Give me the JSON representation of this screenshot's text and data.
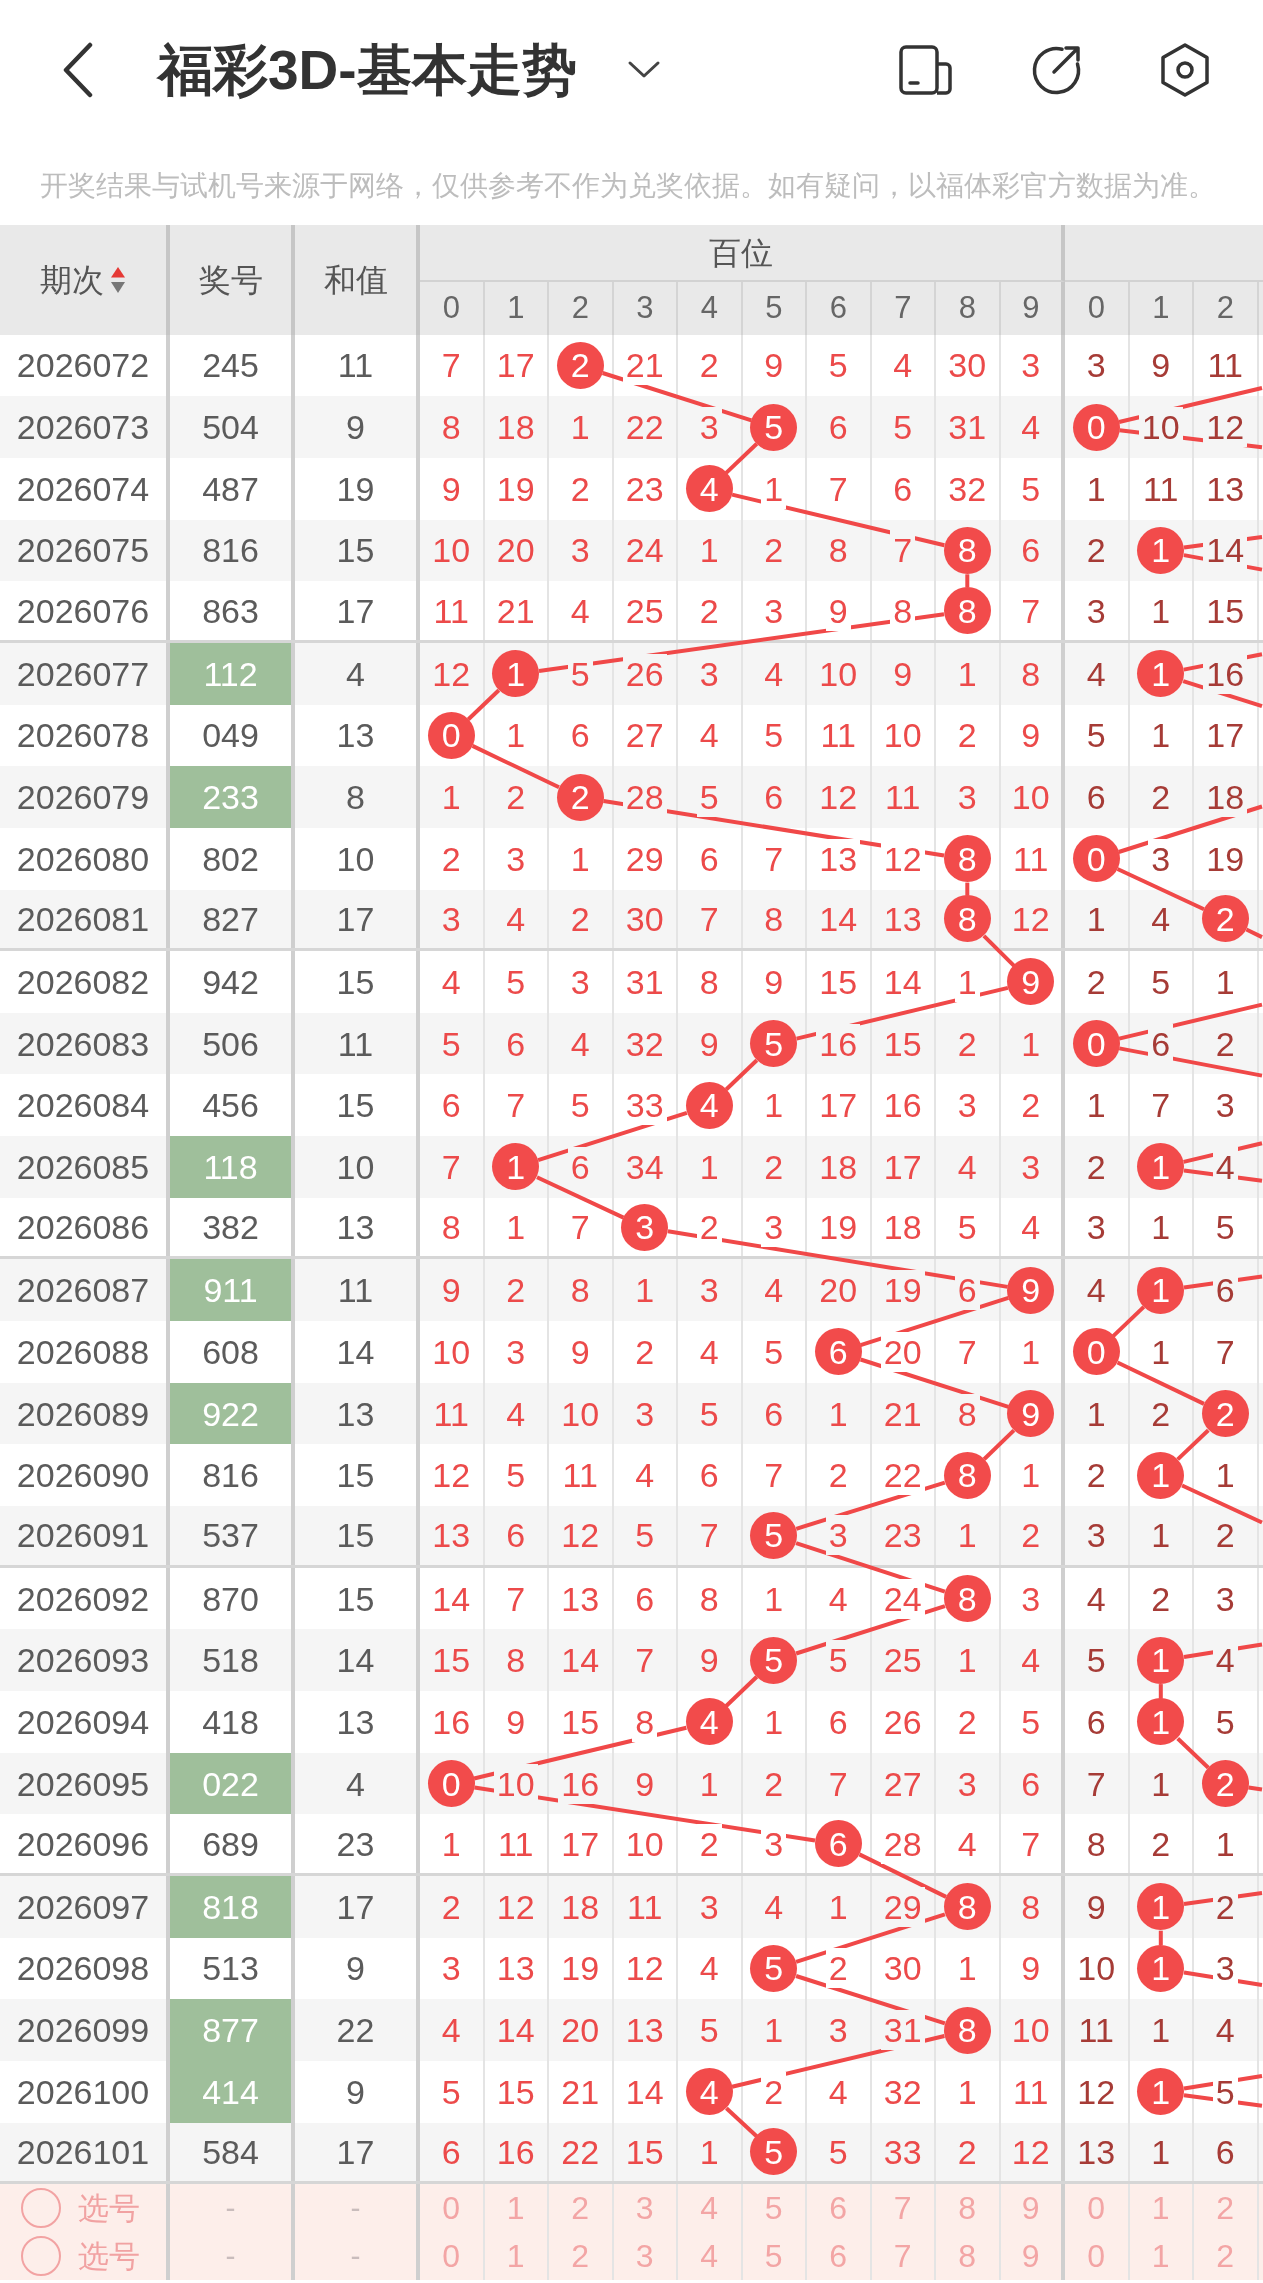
{
  "title_bar": {
    "title": "福彩3D-基本走势"
  },
  "disclaimer": "开奖结果与试机号来源于网络，仅供参考不作为兑奖依据。如有疑问，以福体彩官方数据为准。",
  "table": {
    "headers": {
      "period": "期次",
      "number": "奖号",
      "sum": "和值",
      "hundreds": "百位"
    },
    "sort_ascending": true,
    "hundreds_digits": [
      "0",
      "1",
      "2",
      "3",
      "4",
      "5",
      "6",
      "7",
      "8",
      "9"
    ],
    "tens_digits": [
      "0",
      "1",
      "2"
    ],
    "rows": [
      {
        "period": "2026072",
        "number": "245",
        "sum": "11",
        "highlighted": false,
        "hundreds": [
          {
            "text": "7",
            "hit": false
          },
          {
            "text": "17",
            "hit": false
          },
          {
            "text": "2",
            "hit": true
          },
          {
            "text": "21",
            "hit": false
          },
          {
            "text": "2",
            "hit": false
          },
          {
            "text": "9",
            "hit": false
          },
          {
            "text": "5",
            "hit": false
          },
          {
            "text": "4",
            "hit": false
          },
          {
            "text": "30",
            "hit": false
          },
          {
            "text": "3",
            "hit": false
          }
        ],
        "tens": [
          {
            "text": "3",
            "hit": false
          },
          {
            "text": "9",
            "hit": false
          },
          {
            "text": "11",
            "hit": false
          }
        ]
      },
      {
        "period": "2026073",
        "number": "504",
        "sum": "9",
        "highlighted": false,
        "hundreds": [
          {
            "text": "8",
            "hit": false
          },
          {
            "text": "18",
            "hit": false
          },
          {
            "text": "1",
            "hit": false
          },
          {
            "text": "22",
            "hit": false
          },
          {
            "text": "3",
            "hit": false
          },
          {
            "text": "5",
            "hit": true
          },
          {
            "text": "6",
            "hit": false
          },
          {
            "text": "5",
            "hit": false
          },
          {
            "text": "31",
            "hit": false
          },
          {
            "text": "4",
            "hit": false
          }
        ],
        "tens": [
          {
            "text": "0",
            "hit": true
          },
          {
            "text": "10",
            "hit": false
          },
          {
            "text": "12",
            "hit": false
          }
        ]
      },
      {
        "period": "2026074",
        "number": "487",
        "sum": "19",
        "highlighted": false,
        "hundreds": [
          {
            "text": "9",
            "hit": false
          },
          {
            "text": "19",
            "hit": false
          },
          {
            "text": "2",
            "hit": false
          },
          {
            "text": "23",
            "hit": false
          },
          {
            "text": "4",
            "hit": true
          },
          {
            "text": "1",
            "hit": false
          },
          {
            "text": "7",
            "hit": false
          },
          {
            "text": "6",
            "hit": false
          },
          {
            "text": "32",
            "hit": false
          },
          {
            "text": "5",
            "hit": false
          }
        ],
        "tens": [
          {
            "text": "1",
            "hit": false
          },
          {
            "text": "11",
            "hit": false
          },
          {
            "text": "13",
            "hit": false
          }
        ]
      },
      {
        "period": "2026075",
        "number": "816",
        "sum": "15",
        "highlighted": false,
        "hundreds": [
          {
            "text": "10",
            "hit": false
          },
          {
            "text": "20",
            "hit": false
          },
          {
            "text": "3",
            "hit": false
          },
          {
            "text": "24",
            "hit": false
          },
          {
            "text": "1",
            "hit": false
          },
          {
            "text": "2",
            "hit": false
          },
          {
            "text": "8",
            "hit": false
          },
          {
            "text": "7",
            "hit": false
          },
          {
            "text": "8",
            "hit": true
          },
          {
            "text": "6",
            "hit": false
          }
        ],
        "tens": [
          {
            "text": "2",
            "hit": false
          },
          {
            "text": "1",
            "hit": true
          },
          {
            "text": "14",
            "hit": false
          }
        ]
      },
      {
        "period": "2026076",
        "number": "863",
        "sum": "17",
        "highlighted": false,
        "hundreds": [
          {
            "text": "11",
            "hit": false
          },
          {
            "text": "21",
            "hit": false
          },
          {
            "text": "4",
            "hit": false
          },
          {
            "text": "25",
            "hit": false
          },
          {
            "text": "2",
            "hit": false
          },
          {
            "text": "3",
            "hit": false
          },
          {
            "text": "9",
            "hit": false
          },
          {
            "text": "8",
            "hit": false
          },
          {
            "text": "8",
            "hit": true
          },
          {
            "text": "7",
            "hit": false
          }
        ],
        "tens": [
          {
            "text": "3",
            "hit": false
          },
          {
            "text": "1",
            "hit": false
          },
          {
            "text": "15",
            "hit": false
          }
        ]
      },
      {
        "period": "2026077",
        "number": "112",
        "sum": "4",
        "highlighted": true,
        "hundreds": [
          {
            "text": "12",
            "hit": false
          },
          {
            "text": "1",
            "hit": true
          },
          {
            "text": "5",
            "hit": false
          },
          {
            "text": "26",
            "hit": false
          },
          {
            "text": "3",
            "hit": false
          },
          {
            "text": "4",
            "hit": false
          },
          {
            "text": "10",
            "hit": false
          },
          {
            "text": "9",
            "hit": false
          },
          {
            "text": "1",
            "hit": false
          },
          {
            "text": "8",
            "hit": false
          }
        ],
        "tens": [
          {
            "text": "4",
            "hit": false
          },
          {
            "text": "1",
            "hit": true
          },
          {
            "text": "16",
            "hit": false
          }
        ]
      },
      {
        "period": "2026078",
        "number": "049",
        "sum": "13",
        "highlighted": false,
        "hundreds": [
          {
            "text": "0",
            "hit": true
          },
          {
            "text": "1",
            "hit": false
          },
          {
            "text": "6",
            "hit": false
          },
          {
            "text": "27",
            "hit": false
          },
          {
            "text": "4",
            "hit": false
          },
          {
            "text": "5",
            "hit": false
          },
          {
            "text": "11",
            "hit": false
          },
          {
            "text": "10",
            "hit": false
          },
          {
            "text": "2",
            "hit": false
          },
          {
            "text": "9",
            "hit": false
          }
        ],
        "tens": [
          {
            "text": "5",
            "hit": false
          },
          {
            "text": "1",
            "hit": false
          },
          {
            "text": "17",
            "hit": false
          }
        ]
      },
      {
        "period": "2026079",
        "number": "233",
        "sum": "8",
        "highlighted": true,
        "hundreds": [
          {
            "text": "1",
            "hit": false
          },
          {
            "text": "2",
            "hit": false
          },
          {
            "text": "2",
            "hit": true
          },
          {
            "text": "28",
            "hit": false
          },
          {
            "text": "5",
            "hit": false
          },
          {
            "text": "6",
            "hit": false
          },
          {
            "text": "12",
            "hit": false
          },
          {
            "text": "11",
            "hit": false
          },
          {
            "text": "3",
            "hit": false
          },
          {
            "text": "10",
            "hit": false
          }
        ],
        "tens": [
          {
            "text": "6",
            "hit": false
          },
          {
            "text": "2",
            "hit": false
          },
          {
            "text": "18",
            "hit": false
          }
        ]
      },
      {
        "period": "2026080",
        "number": "802",
        "sum": "10",
        "highlighted": false,
        "hundreds": [
          {
            "text": "2",
            "hit": false
          },
          {
            "text": "3",
            "hit": false
          },
          {
            "text": "1",
            "hit": false
          },
          {
            "text": "29",
            "hit": false
          },
          {
            "text": "6",
            "hit": false
          },
          {
            "text": "7",
            "hit": false
          },
          {
            "text": "13",
            "hit": false
          },
          {
            "text": "12",
            "hit": false
          },
          {
            "text": "8",
            "hit": true
          },
          {
            "text": "11",
            "hit": false
          }
        ],
        "tens": [
          {
            "text": "0",
            "hit": true
          },
          {
            "text": "3",
            "hit": false
          },
          {
            "text": "19",
            "hit": false
          }
        ]
      },
      {
        "period": "2026081",
        "number": "827",
        "sum": "17",
        "highlighted": false,
        "hundreds": [
          {
            "text": "3",
            "hit": false
          },
          {
            "text": "4",
            "hit": false
          },
          {
            "text": "2",
            "hit": false
          },
          {
            "text": "30",
            "hit": false
          },
          {
            "text": "7",
            "hit": false
          },
          {
            "text": "8",
            "hit": false
          },
          {
            "text": "14",
            "hit": false
          },
          {
            "text": "13",
            "hit": false
          },
          {
            "text": "8",
            "hit": true
          },
          {
            "text": "12",
            "hit": false
          }
        ],
        "tens": [
          {
            "text": "1",
            "hit": false
          },
          {
            "text": "4",
            "hit": false
          },
          {
            "text": "2",
            "hit": true
          }
        ]
      },
      {
        "period": "2026082",
        "number": "942",
        "sum": "15",
        "highlighted": false,
        "hundreds": [
          {
            "text": "4",
            "hit": false
          },
          {
            "text": "5",
            "hit": false
          },
          {
            "text": "3",
            "hit": false
          },
          {
            "text": "31",
            "hit": false
          },
          {
            "text": "8",
            "hit": false
          },
          {
            "text": "9",
            "hit": false
          },
          {
            "text": "15",
            "hit": false
          },
          {
            "text": "14",
            "hit": false
          },
          {
            "text": "1",
            "hit": false
          },
          {
            "text": "9",
            "hit": true
          }
        ],
        "tens": [
          {
            "text": "2",
            "hit": false
          },
          {
            "text": "5",
            "hit": false
          },
          {
            "text": "1",
            "hit": false
          }
        ]
      },
      {
        "period": "2026083",
        "number": "506",
        "sum": "11",
        "highlighted": false,
        "hundreds": [
          {
            "text": "5",
            "hit": false
          },
          {
            "text": "6",
            "hit": false
          },
          {
            "text": "4",
            "hit": false
          },
          {
            "text": "32",
            "hit": false
          },
          {
            "text": "9",
            "hit": false
          },
          {
            "text": "5",
            "hit": true
          },
          {
            "text": "16",
            "hit": false
          },
          {
            "text": "15",
            "hit": false
          },
          {
            "text": "2",
            "hit": false
          },
          {
            "text": "1",
            "hit": false
          }
        ],
        "tens": [
          {
            "text": "0",
            "hit": true
          },
          {
            "text": "6",
            "hit": false
          },
          {
            "text": "2",
            "hit": false
          }
        ]
      },
      {
        "period": "2026084",
        "number": "456",
        "sum": "15",
        "highlighted": false,
        "hundreds": [
          {
            "text": "6",
            "hit": false
          },
          {
            "text": "7",
            "hit": false
          },
          {
            "text": "5",
            "hit": false
          },
          {
            "text": "33",
            "hit": false
          },
          {
            "text": "4",
            "hit": true
          },
          {
            "text": "1",
            "hit": false
          },
          {
            "text": "17",
            "hit": false
          },
          {
            "text": "16",
            "hit": false
          },
          {
            "text": "3",
            "hit": false
          },
          {
            "text": "2",
            "hit": false
          }
        ],
        "tens": [
          {
            "text": "1",
            "hit": false
          },
          {
            "text": "7",
            "hit": false
          },
          {
            "text": "3",
            "hit": false
          }
        ]
      },
      {
        "period": "2026085",
        "number": "118",
        "sum": "10",
        "highlighted": true,
        "hundreds": [
          {
            "text": "7",
            "hit": false
          },
          {
            "text": "1",
            "hit": true
          },
          {
            "text": "6",
            "hit": false
          },
          {
            "text": "34",
            "hit": false
          },
          {
            "text": "1",
            "hit": false
          },
          {
            "text": "2",
            "hit": false
          },
          {
            "text": "18",
            "hit": false
          },
          {
            "text": "17",
            "hit": false
          },
          {
            "text": "4",
            "hit": false
          },
          {
            "text": "3",
            "hit": false
          }
        ],
        "tens": [
          {
            "text": "2",
            "hit": false
          },
          {
            "text": "1",
            "hit": true
          },
          {
            "text": "4",
            "hit": false
          }
        ]
      },
      {
        "period": "2026086",
        "number": "382",
        "sum": "13",
        "highlighted": false,
        "hundreds": [
          {
            "text": "8",
            "hit": false
          },
          {
            "text": "1",
            "hit": false
          },
          {
            "text": "7",
            "hit": false
          },
          {
            "text": "3",
            "hit": true
          },
          {
            "text": "2",
            "hit": false
          },
          {
            "text": "3",
            "hit": false
          },
          {
            "text": "19",
            "hit": false
          },
          {
            "text": "18",
            "hit": false
          },
          {
            "text": "5",
            "hit": false
          },
          {
            "text": "4",
            "hit": false
          }
        ],
        "tens": [
          {
            "text": "3",
            "hit": false
          },
          {
            "text": "1",
            "hit": false
          },
          {
            "text": "5",
            "hit": false
          }
        ]
      },
      {
        "period": "2026087",
        "number": "911",
        "sum": "11",
        "highlighted": true,
        "hundreds": [
          {
            "text": "9",
            "hit": false
          },
          {
            "text": "2",
            "hit": false
          },
          {
            "text": "8",
            "hit": false
          },
          {
            "text": "1",
            "hit": false
          },
          {
            "text": "3",
            "hit": false
          },
          {
            "text": "4",
            "hit": false
          },
          {
            "text": "20",
            "hit": false
          },
          {
            "text": "19",
            "hit": false
          },
          {
            "text": "6",
            "hit": false
          },
          {
            "text": "9",
            "hit": true
          }
        ],
        "tens": [
          {
            "text": "4",
            "hit": false
          },
          {
            "text": "1",
            "hit": true
          },
          {
            "text": "6",
            "hit": false
          }
        ]
      },
      {
        "period": "2026088",
        "number": "608",
        "sum": "14",
        "highlighted": false,
        "hundreds": [
          {
            "text": "10",
            "hit": false
          },
          {
            "text": "3",
            "hit": false
          },
          {
            "text": "9",
            "hit": false
          },
          {
            "text": "2",
            "hit": false
          },
          {
            "text": "4",
            "hit": false
          },
          {
            "text": "5",
            "hit": false
          },
          {
            "text": "6",
            "hit": true
          },
          {
            "text": "20",
            "hit": false
          },
          {
            "text": "7",
            "hit": false
          },
          {
            "text": "1",
            "hit": false
          }
        ],
        "tens": [
          {
            "text": "0",
            "hit": true
          },
          {
            "text": "1",
            "hit": false
          },
          {
            "text": "7",
            "hit": false
          }
        ]
      },
      {
        "period": "2026089",
        "number": "922",
        "sum": "13",
        "highlighted": true,
        "hundreds": [
          {
            "text": "11",
            "hit": false
          },
          {
            "text": "4",
            "hit": false
          },
          {
            "text": "10",
            "hit": false
          },
          {
            "text": "3",
            "hit": false
          },
          {
            "text": "5",
            "hit": false
          },
          {
            "text": "6",
            "hit": false
          },
          {
            "text": "1",
            "hit": false
          },
          {
            "text": "21",
            "hit": false
          },
          {
            "text": "8",
            "hit": false
          },
          {
            "text": "9",
            "hit": true
          }
        ],
        "tens": [
          {
            "text": "1",
            "hit": false
          },
          {
            "text": "2",
            "hit": false
          },
          {
            "text": "2",
            "hit": true
          }
        ]
      },
      {
        "period": "2026090",
        "number": "816",
        "sum": "15",
        "highlighted": false,
        "hundreds": [
          {
            "text": "12",
            "hit": false
          },
          {
            "text": "5",
            "hit": false
          },
          {
            "text": "11",
            "hit": false
          },
          {
            "text": "4",
            "hit": false
          },
          {
            "text": "6",
            "hit": false
          },
          {
            "text": "7",
            "hit": false
          },
          {
            "text": "2",
            "hit": false
          },
          {
            "text": "22",
            "hit": false
          },
          {
            "text": "8",
            "hit": true
          },
          {
            "text": "1",
            "hit": false
          }
        ],
        "tens": [
          {
            "text": "2",
            "hit": false
          },
          {
            "text": "1",
            "hit": true
          },
          {
            "text": "1",
            "hit": false
          }
        ]
      },
      {
        "period": "2026091",
        "number": "537",
        "sum": "15",
        "highlighted": false,
        "hundreds": [
          {
            "text": "13",
            "hit": false
          },
          {
            "text": "6",
            "hit": false
          },
          {
            "text": "12",
            "hit": false
          },
          {
            "text": "5",
            "hit": false
          },
          {
            "text": "7",
            "hit": false
          },
          {
            "text": "5",
            "hit": true
          },
          {
            "text": "3",
            "hit": false
          },
          {
            "text": "23",
            "hit": false
          },
          {
            "text": "1",
            "hit": false
          },
          {
            "text": "2",
            "hit": false
          }
        ],
        "tens": [
          {
            "text": "3",
            "hit": false
          },
          {
            "text": "1",
            "hit": false
          },
          {
            "text": "2",
            "hit": false
          }
        ]
      },
      {
        "period": "2026092",
        "number": "870",
        "sum": "15",
        "highlighted": false,
        "hundreds": [
          {
            "text": "14",
            "hit": false
          },
          {
            "text": "7",
            "hit": false
          },
          {
            "text": "13",
            "hit": false
          },
          {
            "text": "6",
            "hit": false
          },
          {
            "text": "8",
            "hit": false
          },
          {
            "text": "1",
            "hit": false
          },
          {
            "text": "4",
            "hit": false
          },
          {
            "text": "24",
            "hit": false
          },
          {
            "text": "8",
            "hit": true
          },
          {
            "text": "3",
            "hit": false
          }
        ],
        "tens": [
          {
            "text": "4",
            "hit": false
          },
          {
            "text": "2",
            "hit": false
          },
          {
            "text": "3",
            "hit": false
          }
        ]
      },
      {
        "period": "2026093",
        "number": "518",
        "sum": "14",
        "highlighted": false,
        "hundreds": [
          {
            "text": "15",
            "hit": false
          },
          {
            "text": "8",
            "hit": false
          },
          {
            "text": "14",
            "hit": false
          },
          {
            "text": "7",
            "hit": false
          },
          {
            "text": "9",
            "hit": false
          },
          {
            "text": "5",
            "hit": true
          },
          {
            "text": "5",
            "hit": false
          },
          {
            "text": "25",
            "hit": false
          },
          {
            "text": "1",
            "hit": false
          },
          {
            "text": "4",
            "hit": false
          }
        ],
        "tens": [
          {
            "text": "5",
            "hit": false
          },
          {
            "text": "1",
            "hit": true
          },
          {
            "text": "4",
            "hit": false
          }
        ]
      },
      {
        "period": "2026094",
        "number": "418",
        "sum": "13",
        "highlighted": false,
        "hundreds": [
          {
            "text": "16",
            "hit": false
          },
          {
            "text": "9",
            "hit": false
          },
          {
            "text": "15",
            "hit": false
          },
          {
            "text": "8",
            "hit": false
          },
          {
            "text": "4",
            "hit": true
          },
          {
            "text": "1",
            "hit": false
          },
          {
            "text": "6",
            "hit": false
          },
          {
            "text": "26",
            "hit": false
          },
          {
            "text": "2",
            "hit": false
          },
          {
            "text": "5",
            "hit": false
          }
        ],
        "tens": [
          {
            "text": "6",
            "hit": false
          },
          {
            "text": "1",
            "hit": true
          },
          {
            "text": "5",
            "hit": false
          }
        ]
      },
      {
        "period": "2026095",
        "number": "022",
        "sum": "4",
        "highlighted": true,
        "hundreds": [
          {
            "text": "0",
            "hit": true
          },
          {
            "text": "10",
            "hit": false
          },
          {
            "text": "16",
            "hit": false
          },
          {
            "text": "9",
            "hit": false
          },
          {
            "text": "1",
            "hit": false
          },
          {
            "text": "2",
            "hit": false
          },
          {
            "text": "7",
            "hit": false
          },
          {
            "text": "27",
            "hit": false
          },
          {
            "text": "3",
            "hit": false
          },
          {
            "text": "6",
            "hit": false
          }
        ],
        "tens": [
          {
            "text": "7",
            "hit": false
          },
          {
            "text": "1",
            "hit": false
          },
          {
            "text": "2",
            "hit": true
          }
        ]
      },
      {
        "period": "2026096",
        "number": "689",
        "sum": "23",
        "highlighted": false,
        "hundreds": [
          {
            "text": "1",
            "hit": false
          },
          {
            "text": "11",
            "hit": false
          },
          {
            "text": "17",
            "hit": false
          },
          {
            "text": "10",
            "hit": false
          },
          {
            "text": "2",
            "hit": false
          },
          {
            "text": "3",
            "hit": false
          },
          {
            "text": "6",
            "hit": true
          },
          {
            "text": "28",
            "hit": false
          },
          {
            "text": "4",
            "hit": false
          },
          {
            "text": "7",
            "hit": false
          }
        ],
        "tens": [
          {
            "text": "8",
            "hit": false
          },
          {
            "text": "2",
            "hit": false
          },
          {
            "text": "1",
            "hit": false
          }
        ]
      },
      {
        "period": "2026097",
        "number": "818",
        "sum": "17",
        "highlighted": true,
        "hundreds": [
          {
            "text": "2",
            "hit": false
          },
          {
            "text": "12",
            "hit": false
          },
          {
            "text": "18",
            "hit": false
          },
          {
            "text": "11",
            "hit": false
          },
          {
            "text": "3",
            "hit": false
          },
          {
            "text": "4",
            "hit": false
          },
          {
            "text": "1",
            "hit": false
          },
          {
            "text": "29",
            "hit": false
          },
          {
            "text": "8",
            "hit": true
          },
          {
            "text": "8",
            "hit": false
          }
        ],
        "tens": [
          {
            "text": "9",
            "hit": false
          },
          {
            "text": "1",
            "hit": true
          },
          {
            "text": "2",
            "hit": false
          }
        ]
      },
      {
        "period": "2026098",
        "number": "513",
        "sum": "9",
        "highlighted": false,
        "hundreds": [
          {
            "text": "3",
            "hit": false
          },
          {
            "text": "13",
            "hit": false
          },
          {
            "text": "19",
            "hit": false
          },
          {
            "text": "12",
            "hit": false
          },
          {
            "text": "4",
            "hit": false
          },
          {
            "text": "5",
            "hit": true
          },
          {
            "text": "2",
            "hit": false
          },
          {
            "text": "30",
            "hit": false
          },
          {
            "text": "1",
            "hit": false
          },
          {
            "text": "9",
            "hit": false
          }
        ],
        "tens": [
          {
            "text": "10",
            "hit": false
          },
          {
            "text": "1",
            "hit": true
          },
          {
            "text": "3",
            "hit": false
          }
        ]
      },
      {
        "period": "2026099",
        "number": "877",
        "sum": "22",
        "highlighted": true,
        "hundreds": [
          {
            "text": "4",
            "hit": false
          },
          {
            "text": "14",
            "hit": false
          },
          {
            "text": "20",
            "hit": false
          },
          {
            "text": "13",
            "hit": false
          },
          {
            "text": "5",
            "hit": false
          },
          {
            "text": "1",
            "hit": false
          },
          {
            "text": "3",
            "hit": false
          },
          {
            "text": "31",
            "hit": false
          },
          {
            "text": "8",
            "hit": true
          },
          {
            "text": "10",
            "hit": false
          }
        ],
        "tens": [
          {
            "text": "11",
            "hit": false
          },
          {
            "text": "1",
            "hit": false
          },
          {
            "text": "4",
            "hit": false
          }
        ]
      },
      {
        "period": "2026100",
        "number": "414",
        "sum": "9",
        "highlighted": true,
        "hundreds": [
          {
            "text": "5",
            "hit": false
          },
          {
            "text": "15",
            "hit": false
          },
          {
            "text": "21",
            "hit": false
          },
          {
            "text": "14",
            "hit": false
          },
          {
            "text": "4",
            "hit": true
          },
          {
            "text": "2",
            "hit": false
          },
          {
            "text": "4",
            "hit": false
          },
          {
            "text": "32",
            "hit": false
          },
          {
            "text": "1",
            "hit": false
          },
          {
            "text": "11",
            "hit": false
          }
        ],
        "tens": [
          {
            "text": "12",
            "hit": false
          },
          {
            "text": "1",
            "hit": true
          },
          {
            "text": "5",
            "hit": false
          }
        ]
      },
      {
        "period": "2026101",
        "number": "584",
        "sum": "17",
        "highlighted": false,
        "hundreds": [
          {
            "text": "6",
            "hit": false
          },
          {
            "text": "16",
            "hit": false
          },
          {
            "text": "22",
            "hit": false
          },
          {
            "text": "15",
            "hit": false
          },
          {
            "text": "1",
            "hit": false
          },
          {
            "text": "5",
            "hit": true
          },
          {
            "text": "5",
            "hit": false
          },
          {
            "text": "33",
            "hit": false
          },
          {
            "text": "2",
            "hit": false
          },
          {
            "text": "12",
            "hit": false
          }
        ],
        "tens": [
          {
            "text": "13",
            "hit": false
          },
          {
            "text": "1",
            "hit": false
          },
          {
            "text": "6",
            "hit": false
          }
        ]
      }
    ],
    "pick_rows": [
      {
        "label": "选号",
        "selected": false,
        "number": "-",
        "sum": "-",
        "hundreds": [
          {
            "text": "0",
            "selected": false
          },
          {
            "text": "1",
            "selected": false
          },
          {
            "text": "2",
            "selected": false
          },
          {
            "text": "3",
            "selected": false
          },
          {
            "text": "4",
            "selected": false
          },
          {
            "text": "5",
            "selected": false
          },
          {
            "text": "6",
            "selected": false
          },
          {
            "text": "7",
            "selected": false
          },
          {
            "text": "8",
            "selected": false
          },
          {
            "text": "9",
            "selected": false
          }
        ],
        "tens": [
          {
            "text": "0",
            "selected": false
          },
          {
            "text": "1",
            "selected": false
          },
          {
            "text": "2",
            "selected": false
          }
        ]
      },
      {
        "label": "选号",
        "selected": false,
        "number": "-",
        "sum": "-",
        "hundreds": [
          {
            "text": "0",
            "selected": false
          },
          {
            "text": "1",
            "selected": false
          },
          {
            "text": "2",
            "selected": false
          },
          {
            "text": "3",
            "selected": false
          },
          {
            "text": "4",
            "selected": false
          },
          {
            "text": "5",
            "selected": false
          },
          {
            "text": "6",
            "selected": false
          },
          {
            "text": "7",
            "selected": false
          },
          {
            "text": "8",
            "selected": false
          },
          {
            "text": "9",
            "selected": false
          }
        ],
        "tens": [
          {
            "text": "0",
            "selected": false
          },
          {
            "text": "1",
            "selected": false
          },
          {
            "text": "2",
            "selected": false
          }
        ]
      }
    ]
  }
}
